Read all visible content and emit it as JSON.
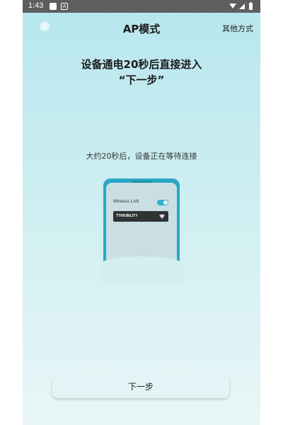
{
  "status_bar": {
    "time": "1:43",
    "app_icon_label": "A",
    "icons": [
      "notification-square-icon",
      "app-a-icon",
      "wifi-icon",
      "signal-icon",
      "battery-icon"
    ]
  },
  "header": {
    "title": "AP模式",
    "other_methods": "其他方式",
    "back_icon": "back-arrow-icon"
  },
  "main": {
    "instruction_line1": "设备通电20秒后直接进入",
    "instruction_line2": "“下一步”",
    "wait_text": "大约20秒后，设备正在等待连接"
  },
  "illustration": {
    "wlan_label": "Wireless LAN",
    "toggle_on": true,
    "network_name": "TTNIUBILITY",
    "network_icon": "wifi-icon"
  },
  "footer": {
    "next_label": "下一步"
  },
  "colors": {
    "accent": "#2aa8c6",
    "background_top": "#b6e6ee",
    "background_bottom": "#e9f6f7",
    "status_bar": "#5e5e5e"
  }
}
